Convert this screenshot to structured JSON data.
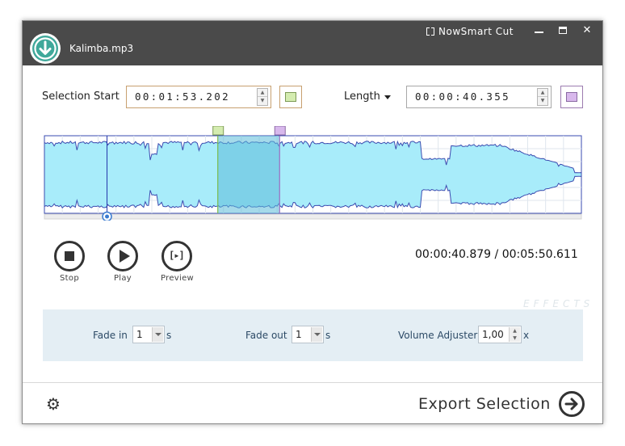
{
  "window": {
    "file_name": "Kalimba.mp3",
    "brand": "NowSmart Cut",
    "controls": {
      "minimize": "minimize",
      "maximize": "maximize",
      "close": "✕"
    }
  },
  "selection": {
    "start_label": "Selection Start",
    "start_value": "00:01:53.202",
    "length_label": "Length",
    "length_value": "00:00:40.355",
    "start_color": "#d4ecb0",
    "length_color": "#d8b8ec"
  },
  "waveform": {
    "total_duration_s": 350.611,
    "selection_start_s": 113.202,
    "selection_length_s": 40.355,
    "playhead_s": 40.879,
    "fill_color": "#a8ecfa",
    "line_color": "#3a4bb0",
    "selection_color": "#5bbcd8"
  },
  "transport": {
    "stop_label": "Stop",
    "play_label": "Play",
    "preview_label": "Preview",
    "position": "00:00:40.879",
    "separator": "/",
    "duration": "00:05:50.611"
  },
  "effects": {
    "watermark": "EFFECTS",
    "fade_in_label": "Fade in",
    "fade_in_value": "1",
    "fade_in_unit": "s",
    "fade_out_label": "Fade out",
    "fade_out_value": "1",
    "fade_out_unit": "s",
    "volume_label": "Volume Adjuster",
    "volume_value": "1,00",
    "volume_unit": "x"
  },
  "footer": {
    "export_label": "Export Selection",
    "settings_icon": "gear-icon"
  }
}
